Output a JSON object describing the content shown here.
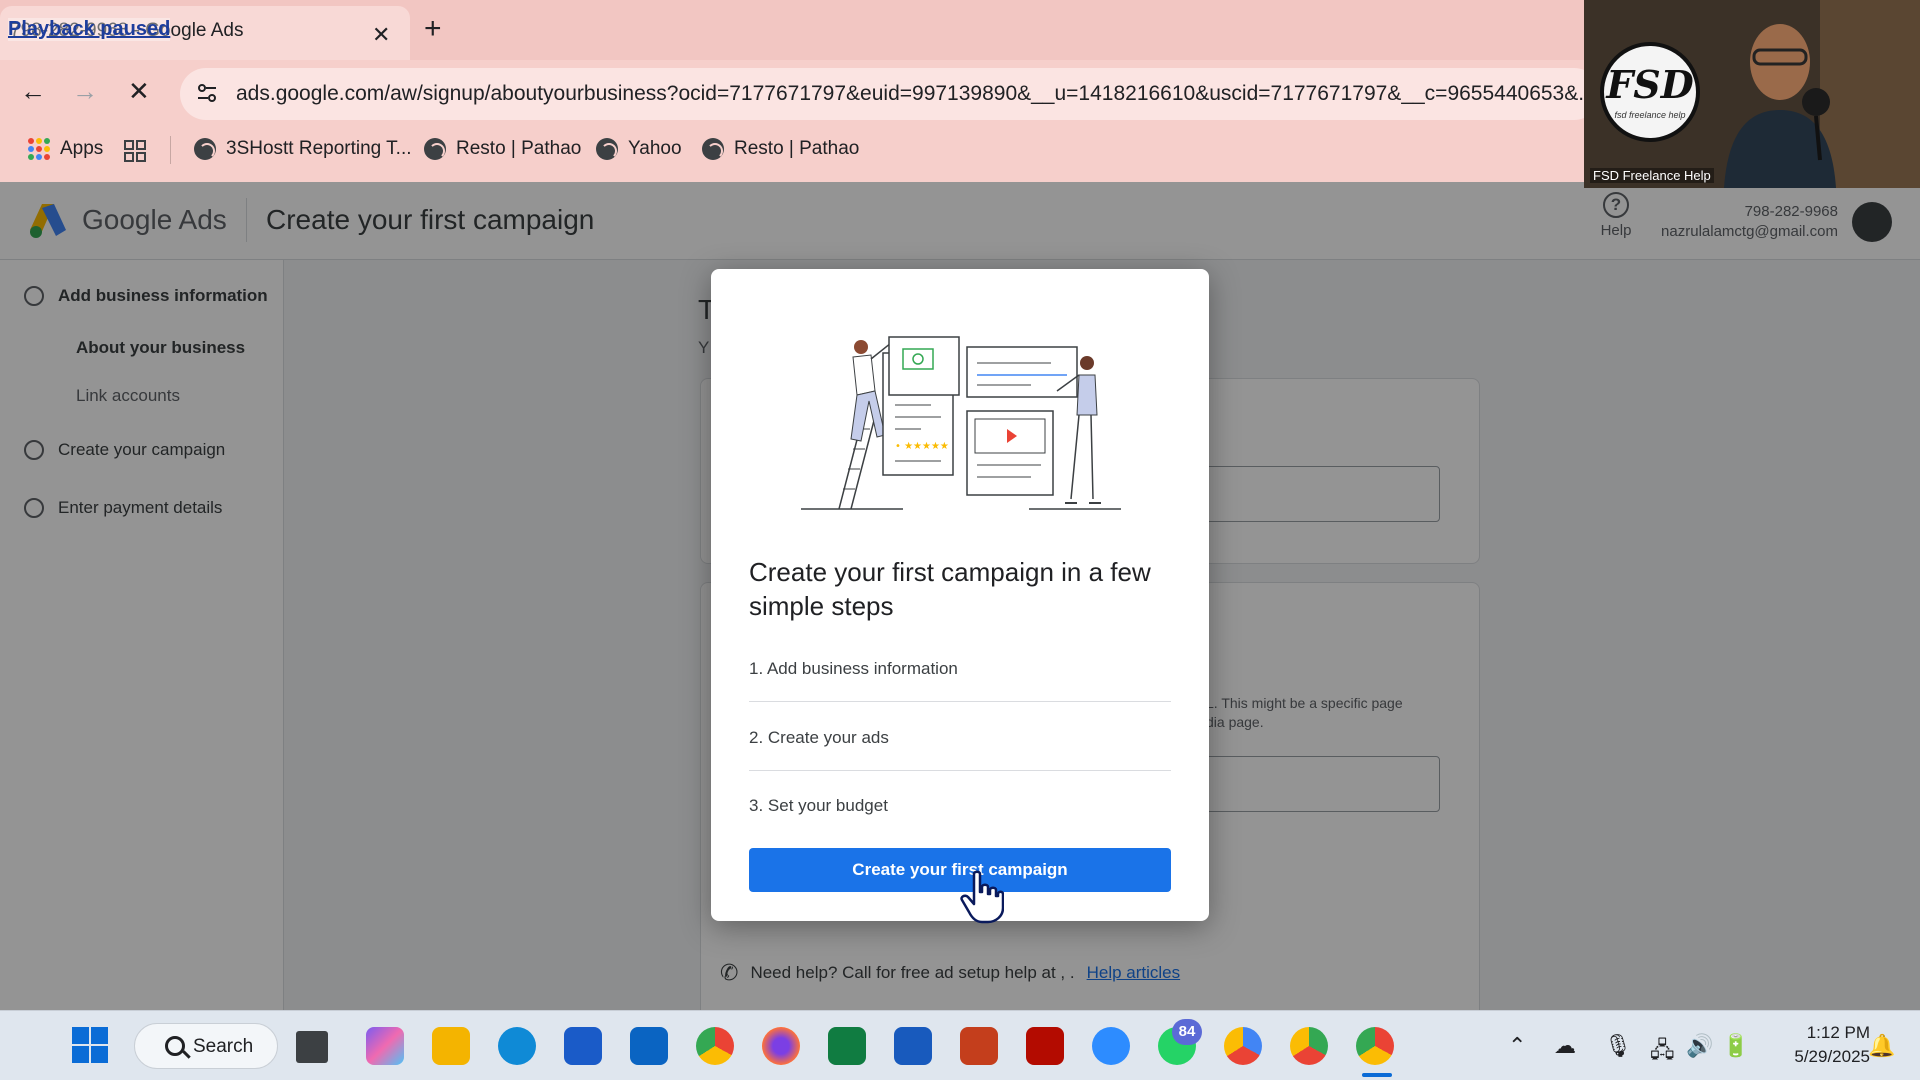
{
  "browser": {
    "overlay_label": "Playback paused",
    "tab_title": "798-282-9968 - Google Ads",
    "tab_close": "✕",
    "new_tab": "+",
    "url": "ads.google.com/aw/signup/aboutyourbusiness?ocid=7177671797&euid=997139890&__u=1418216610&uscid=7177671797&__c=9655440653&...",
    "bookmarks": [
      {
        "label": "Apps"
      },
      {
        "label": "3SHostt Reporting T..."
      },
      {
        "label": "Resto | Pathao"
      },
      {
        "label": "Yahoo"
      },
      {
        "label": "Resto | Pathao"
      }
    ]
  },
  "header": {
    "brand_word": "Google Ads",
    "page_title": "Create your first campaign",
    "help_label": "Help",
    "help_glyph": "?",
    "account_phone": "798-282-9968",
    "account_email": "nazrulalamctg@gmail.com"
  },
  "sidebar": {
    "steps": [
      {
        "label": "Add business information"
      },
      {
        "label": "Create your campaign"
      },
      {
        "label": "Enter payment details"
      }
    ],
    "substeps": [
      {
        "label": "About your business"
      },
      {
        "label": "Link accounts"
      }
    ]
  },
  "background_page": {
    "ghost_t": "T",
    "ghost_y": "Y",
    "hint_line1": "L. This might be a specific page",
    "hint_line2": "dia page.",
    "help_text": "Need help? Call for free ad setup help at , .",
    "help_link": "Help articles"
  },
  "modal": {
    "title": "Create your first campaign in a few simple steps",
    "items": [
      {
        "label": "1. Add business information"
      },
      {
        "label": "2. Create your ads"
      },
      {
        "label": "3. Set your budget"
      }
    ],
    "cta_label": "Create your first campaign"
  },
  "webcam": {
    "logo_text": "FSD",
    "logo_sub": "fsd freelance help",
    "caption": "FSD Freelance Help"
  },
  "taskbar": {
    "search_label": "Search",
    "whatsapp_badge": "84",
    "time": "1:12 PM",
    "date": "5/29/2025"
  },
  "colors": {
    "accent_blue": "#1a73e8",
    "chrome_pink": "#f6cfcb",
    "scrim": "rgba(0,0,0,0.42)"
  }
}
